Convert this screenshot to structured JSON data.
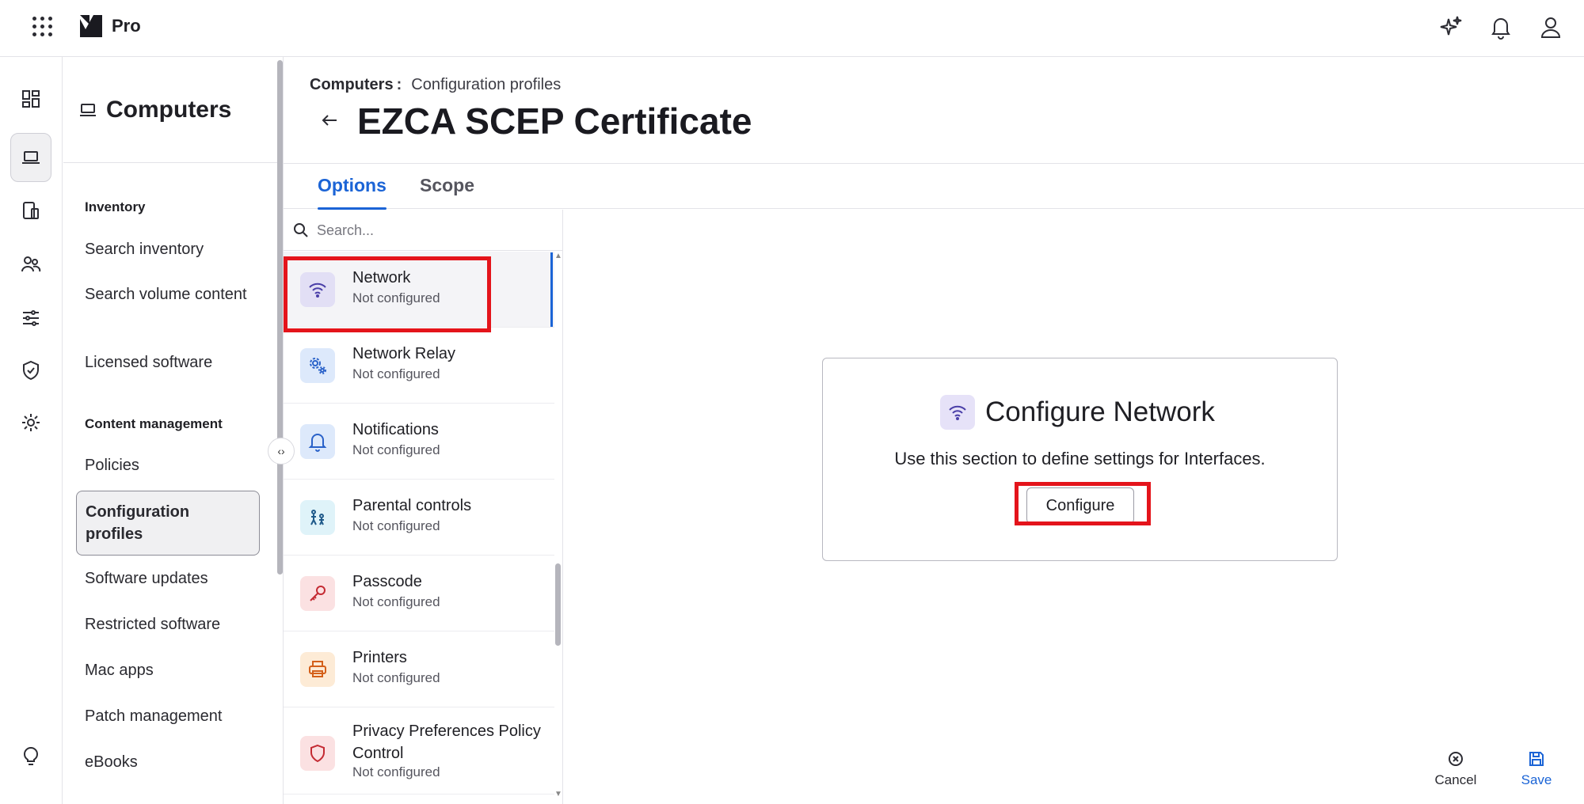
{
  "app": {
    "product": "Pro"
  },
  "secnav": {
    "title": "Computers",
    "sections": [
      {
        "label": "Inventory"
      },
      {
        "label": "Content management"
      }
    ],
    "items": [
      {
        "label": "Search inventory"
      },
      {
        "label": "Search volume content"
      },
      {
        "label": "Licensed software"
      },
      {
        "label": "Policies"
      },
      {
        "label": "Configuration profiles"
      },
      {
        "label": "Software updates"
      },
      {
        "label": "Restricted software"
      },
      {
        "label": "Mac apps"
      },
      {
        "label": "Patch management"
      },
      {
        "label": "eBooks"
      }
    ]
  },
  "breadcrumb": {
    "parent": "Computers",
    "separator": ":",
    "current": "Configuration profiles"
  },
  "page": {
    "title": "EZCA SCEP Certificate"
  },
  "tabs": [
    {
      "label": "Options"
    },
    {
      "label": "Scope"
    }
  ],
  "search": {
    "placeholder": "Search..."
  },
  "payloads": [
    {
      "name": "Network",
      "status": "Not configured",
      "icon": "wifi-icon"
    },
    {
      "name": "Network Relay",
      "status": "Not configured",
      "icon": "gears-icon"
    },
    {
      "name": "Notifications",
      "status": "Not configured",
      "icon": "bell-icon"
    },
    {
      "name": "Parental controls",
      "status": "Not configured",
      "icon": "family-icon"
    },
    {
      "name": "Passcode",
      "status": "Not configured",
      "icon": "key-icon"
    },
    {
      "name": "Printers",
      "status": "Not configured",
      "icon": "printer-icon"
    },
    {
      "name": "Privacy Preferences Policy Control",
      "status": "Not configured",
      "icon": "shield-icon"
    }
  ],
  "config_card": {
    "title": "Configure Network",
    "description": "Use this section to define settings for Interfaces.",
    "button": "Configure"
  },
  "footer": {
    "cancel": "Cancel",
    "save": "Save"
  },
  "colors": {
    "accent": "#1b64d6",
    "highlight": "#e4141b"
  }
}
